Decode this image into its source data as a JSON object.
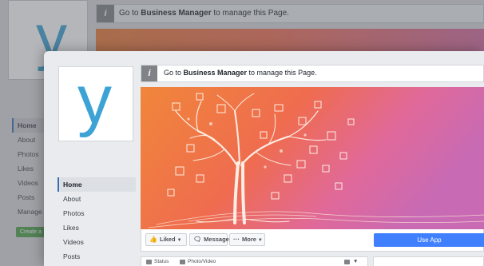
{
  "page_logo_letter": "y",
  "notice": {
    "prefix": "Go to ",
    "link": "Business Manager",
    "suffix": " to manage this Page.",
    "icon": "info-icon"
  },
  "nav": {
    "items": [
      {
        "label": "Home",
        "active": true
      },
      {
        "label": "About"
      },
      {
        "label": "Photos"
      },
      {
        "label": "Likes"
      },
      {
        "label": "Videos"
      },
      {
        "label": "Posts"
      }
    ]
  },
  "bg_nav": {
    "items": [
      "Home",
      "About",
      "Photos",
      "Likes",
      "Videos",
      "Posts",
      "Manage"
    ],
    "create_label": "Create a"
  },
  "actions": {
    "liked": "Liked",
    "message": "Message",
    "more": "More",
    "use_app": "Use App"
  },
  "composer": {
    "status": "Status",
    "photo_video": "Photo/Video"
  },
  "colors": {
    "accent": "#4080ff",
    "logo": "#3da3d5",
    "cover_start": "#f0863a",
    "cover_end": "#c86ab4",
    "active_border": "#3b6fb5"
  }
}
